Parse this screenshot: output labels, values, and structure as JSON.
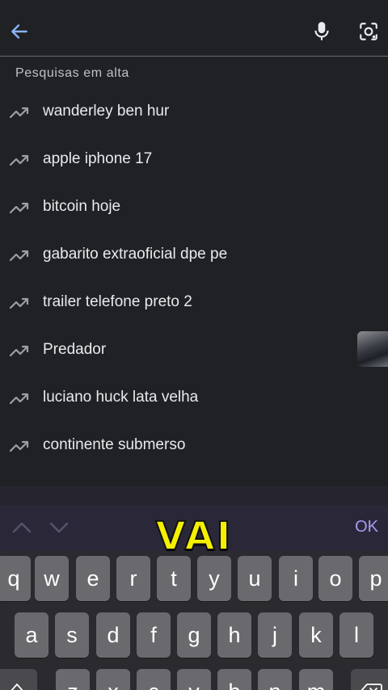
{
  "search": {
    "back_icon": "arrow-left-icon",
    "mic_icon": "mic-icon",
    "lens_icon": "camera-lens-icon",
    "accent": "#8ab4f8"
  },
  "trending": {
    "title": "Pesquisas em alta",
    "items": [
      {
        "label": "wanderley ben hur"
      },
      {
        "label": "apple iphone 17"
      },
      {
        "label": "bitcoin hoje"
      },
      {
        "label": "gabarito extraoficial dpe pe"
      },
      {
        "label": "trailer telefone preto 2"
      },
      {
        "label": "Predador"
      },
      {
        "label": "luciano huck lata velha"
      },
      {
        "label": "continente submerso"
      }
    ]
  },
  "keyboard": {
    "ok_label": "OK",
    "row1": [
      "q",
      "w",
      "e",
      "r",
      "t",
      "y",
      "u",
      "i",
      "o",
      "p"
    ],
    "row2": [
      "a",
      "s",
      "d",
      "f",
      "g",
      "h",
      "j",
      "k",
      "l"
    ],
    "row3": [
      "z",
      "x",
      "c",
      "v",
      "b",
      "n",
      "m"
    ]
  },
  "overlay": {
    "caption": "VAI",
    "caption_color": "#f4f000"
  }
}
